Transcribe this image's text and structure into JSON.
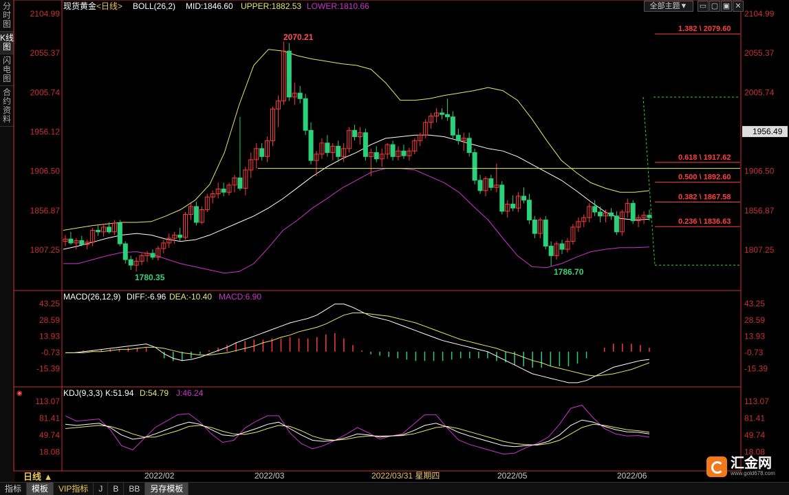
{
  "sidebar": {
    "items": [
      "分时图",
      "K线图",
      "闪电图",
      "合约资料"
    ],
    "active": 1
  },
  "top_controls": {
    "theme_label": "全部主题▼"
  },
  "main_header": {
    "name": "现货黄金",
    "period": "<日线>",
    "indicator": "BOLL(26,2)",
    "mid": "MID:1846.60",
    "upper": "UPPER:1882.53",
    "lower": "LOWER:1810.66"
  },
  "macd_header": {
    "name": "MACD(26,12,9)",
    "diff": "DIFF:-6.96",
    "dea": "DEA:-10.40",
    "macd": "MACD:6.90"
  },
  "kdj_header": {
    "name": "KDJ(9,3,3)",
    "k": "K:51.94",
    "d": "D:54.79",
    "j": "J:46.24"
  },
  "price_axis": {
    "ticks": [
      "2104.99",
      "2055.37",
      "2005.74",
      "1956.12",
      "1906.50",
      "1856.87",
      "1807.25"
    ],
    "current": "1956.49"
  },
  "macd_axis": {
    "ticks": [
      "43.25",
      "28.59",
      "13.93",
      "-0.73",
      "-15.39"
    ]
  },
  "kdj_axis": {
    "ticks": [
      "113.07",
      "81.41",
      "49.74",
      "18.08"
    ]
  },
  "fib_levels": [
    {
      "label": "1.382 \\ 2079.60",
      "value": 2079.6
    },
    {
      "label": "0.618 \\ 1917.62",
      "value": 1917.62
    },
    {
      "label": "0.500 \\ 1892.60",
      "value": 1892.6
    },
    {
      "label": "0.382 \\ 1867.58",
      "value": 1867.58
    },
    {
      "label": "0.236 \\ 1836.63",
      "value": 1836.63
    }
  ],
  "annotations": {
    "high": "2070.21",
    "low1": "1780.35",
    "low2": "1786.70"
  },
  "x_axis": {
    "labels": [
      "2022/02",
      "2022/03",
      "2022/03/31 星期四",
      "2022/05",
      "2022/06"
    ],
    "period_label": "日线 ▲"
  },
  "bottom_tabs": [
    "指标",
    "模板",
    "VIP指标",
    "J",
    "B",
    "BB",
    "另存模板"
  ],
  "brand": {
    "name": "汇金网",
    "url": "www.gold678.com"
  },
  "colors": {
    "up": "#ff3b3b",
    "down": "#2ad07a",
    "mid": "#ffffff",
    "upper": "#e8e86a",
    "lower": "#cc33cc",
    "axis": "#c83030"
  },
  "chart_data": {
    "type": "candlestick",
    "series_name": "现货黄金",
    "y_range": [
      1780,
      2110
    ],
    "candles": [
      {
        "o": 1818,
        "h": 1826,
        "l": 1812,
        "c": 1821
      },
      {
        "o": 1821,
        "h": 1830,
        "l": 1814,
        "c": 1816
      },
      {
        "o": 1816,
        "h": 1822,
        "l": 1808,
        "c": 1819
      },
      {
        "o": 1819,
        "h": 1825,
        "l": 1812,
        "c": 1814
      },
      {
        "o": 1814,
        "h": 1820,
        "l": 1808,
        "c": 1817
      },
      {
        "o": 1817,
        "h": 1835,
        "l": 1812,
        "c": 1832
      },
      {
        "o": 1832,
        "h": 1838,
        "l": 1825,
        "c": 1830
      },
      {
        "o": 1830,
        "h": 1840,
        "l": 1824,
        "c": 1836
      },
      {
        "o": 1836,
        "h": 1842,
        "l": 1828,
        "c": 1830
      },
      {
        "o": 1830,
        "h": 1845,
        "l": 1826,
        "c": 1841
      },
      {
        "o": 1841,
        "h": 1845,
        "l": 1812,
        "c": 1815
      },
      {
        "o": 1815,
        "h": 1818,
        "l": 1790,
        "c": 1795
      },
      {
        "o": 1795,
        "h": 1800,
        "l": 1782,
        "c": 1788
      },
      {
        "o": 1788,
        "h": 1798,
        "l": 1780,
        "c": 1793
      },
      {
        "o": 1793,
        "h": 1803,
        "l": 1788,
        "c": 1800
      },
      {
        "o": 1800,
        "h": 1806,
        "l": 1792,
        "c": 1803
      },
      {
        "o": 1803,
        "h": 1808,
        "l": 1795,
        "c": 1798
      },
      {
        "o": 1798,
        "h": 1812,
        "l": 1794,
        "c": 1809
      },
      {
        "o": 1809,
        "h": 1820,
        "l": 1803,
        "c": 1816
      },
      {
        "o": 1816,
        "h": 1828,
        "l": 1810,
        "c": 1822
      },
      {
        "o": 1822,
        "h": 1830,
        "l": 1815,
        "c": 1826
      },
      {
        "o": 1826,
        "h": 1835,
        "l": 1818,
        "c": 1823
      },
      {
        "o": 1823,
        "h": 1855,
        "l": 1820,
        "c": 1852
      },
      {
        "o": 1852,
        "h": 1866,
        "l": 1845,
        "c": 1862
      },
      {
        "o": 1862,
        "h": 1868,
        "l": 1838,
        "c": 1842
      },
      {
        "o": 1842,
        "h": 1862,
        "l": 1840,
        "c": 1858
      },
      {
        "o": 1858,
        "h": 1878,
        "l": 1855,
        "c": 1874
      },
      {
        "o": 1874,
        "h": 1882,
        "l": 1866,
        "c": 1878
      },
      {
        "o": 1878,
        "h": 1892,
        "l": 1872,
        "c": 1884
      },
      {
        "o": 1884,
        "h": 1892,
        "l": 1875,
        "c": 1880
      },
      {
        "o": 1880,
        "h": 1892,
        "l": 1876,
        "c": 1889
      },
      {
        "o": 1889,
        "h": 1902,
        "l": 1880,
        "c": 1898
      },
      {
        "o": 1898,
        "h": 1975,
        "l": 1882,
        "c": 1885
      },
      {
        "o": 1885,
        "h": 1912,
        "l": 1876,
        "c": 1908
      },
      {
        "o": 1908,
        "h": 1930,
        "l": 1898,
        "c": 1921
      },
      {
        "o": 1921,
        "h": 1942,
        "l": 1910,
        "c": 1935
      },
      {
        "o": 1935,
        "h": 1942,
        "l": 1920,
        "c": 1925
      },
      {
        "o": 1925,
        "h": 1950,
        "l": 1918,
        "c": 1945
      },
      {
        "o": 1945,
        "h": 1988,
        "l": 1938,
        "c": 1985
      },
      {
        "o": 1985,
        "h": 2002,
        "l": 1962,
        "c": 1995
      },
      {
        "o": 1995,
        "h": 2070,
        "l": 1990,
        "c": 2058
      },
      {
        "o": 2058,
        "h": 2068,
        "l": 1995,
        "c": 2000
      },
      {
        "o": 2000,
        "h": 2018,
        "l": 1990,
        "c": 2005
      },
      {
        "o": 2005,
        "h": 2014,
        "l": 1992,
        "c": 1998
      },
      {
        "o": 1998,
        "h": 2004,
        "l": 1952,
        "c": 1958
      },
      {
        "o": 1958,
        "h": 1968,
        "l": 1915,
        "c": 1920
      },
      {
        "o": 1920,
        "h": 1932,
        "l": 1900,
        "c": 1928
      },
      {
        "o": 1928,
        "h": 1948,
        "l": 1922,
        "c": 1942
      },
      {
        "o": 1942,
        "h": 1952,
        "l": 1925,
        "c": 1930
      },
      {
        "o": 1930,
        "h": 1942,
        "l": 1920,
        "c": 1938
      },
      {
        "o": 1938,
        "h": 1945,
        "l": 1918,
        "c": 1925
      },
      {
        "o": 1925,
        "h": 1942,
        "l": 1918,
        "c": 1935
      },
      {
        "o": 1935,
        "h": 1962,
        "l": 1930,
        "c": 1958
      },
      {
        "o": 1958,
        "h": 1965,
        "l": 1945,
        "c": 1950
      },
      {
        "o": 1950,
        "h": 1962,
        "l": 1940,
        "c": 1955
      },
      {
        "o": 1955,
        "h": 1960,
        "l": 1920,
        "c": 1925
      },
      {
        "o": 1925,
        "h": 1935,
        "l": 1900,
        "c": 1930
      },
      {
        "o": 1930,
        "h": 1938,
        "l": 1918,
        "c": 1922
      },
      {
        "o": 1922,
        "h": 1935,
        "l": 1912,
        "c": 1928
      },
      {
        "o": 1928,
        "h": 1942,
        "l": 1922,
        "c": 1940
      },
      {
        "o": 1940,
        "h": 1945,
        "l": 1920,
        "c": 1925
      },
      {
        "o": 1925,
        "h": 1938,
        "l": 1920,
        "c": 1932
      },
      {
        "o": 1932,
        "h": 1940,
        "l": 1922,
        "c": 1926
      },
      {
        "o": 1926,
        "h": 1936,
        "l": 1920,
        "c": 1932
      },
      {
        "o": 1932,
        "h": 1948,
        "l": 1928,
        "c": 1945
      },
      {
        "o": 1945,
        "h": 1955,
        "l": 1938,
        "c": 1952
      },
      {
        "o": 1952,
        "h": 1972,
        "l": 1948,
        "c": 1968
      },
      {
        "o": 1968,
        "h": 1980,
        "l": 1960,
        "c": 1976
      },
      {
        "o": 1976,
        "h": 1986,
        "l": 1968,
        "c": 1980
      },
      {
        "o": 1980,
        "h": 1986,
        "l": 1972,
        "c": 1978
      },
      {
        "o": 1978,
        "h": 1998,
        "l": 1970,
        "c": 1975
      },
      {
        "o": 1975,
        "h": 1982,
        "l": 1948,
        "c": 1952
      },
      {
        "o": 1952,
        "h": 1960,
        "l": 1940,
        "c": 1945
      },
      {
        "o": 1945,
        "h": 1955,
        "l": 1932,
        "c": 1948
      },
      {
        "o": 1948,
        "h": 1955,
        "l": 1925,
        "c": 1930
      },
      {
        "o": 1930,
        "h": 1935,
        "l": 1890,
        "c": 1895
      },
      {
        "o": 1895,
        "h": 1902,
        "l": 1878,
        "c": 1882
      },
      {
        "o": 1882,
        "h": 1900,
        "l": 1875,
        "c": 1897
      },
      {
        "o": 1897,
        "h": 1902,
        "l": 1882,
        "c": 1886
      },
      {
        "o": 1886,
        "h": 1916,
        "l": 1880,
        "c": 1889
      },
      {
        "o": 1889,
        "h": 1894,
        "l": 1852,
        "c": 1856
      },
      {
        "o": 1856,
        "h": 1870,
        "l": 1848,
        "c": 1865
      },
      {
        "o": 1865,
        "h": 1876,
        "l": 1856,
        "c": 1860
      },
      {
        "o": 1860,
        "h": 1880,
        "l": 1855,
        "c": 1875
      },
      {
        "o": 1875,
        "h": 1886,
        "l": 1866,
        "c": 1870
      },
      {
        "o": 1870,
        "h": 1878,
        "l": 1840,
        "c": 1845
      },
      {
        "o": 1845,
        "h": 1850,
        "l": 1822,
        "c": 1828
      },
      {
        "o": 1828,
        "h": 1848,
        "l": 1822,
        "c": 1845
      },
      {
        "o": 1845,
        "h": 1850,
        "l": 1808,
        "c": 1812
      },
      {
        "o": 1812,
        "h": 1818,
        "l": 1787,
        "c": 1800
      },
      {
        "o": 1800,
        "h": 1818,
        "l": 1795,
        "c": 1815
      },
      {
        "o": 1815,
        "h": 1820,
        "l": 1802,
        "c": 1808
      },
      {
        "o": 1808,
        "h": 1822,
        "l": 1804,
        "c": 1818
      },
      {
        "o": 1818,
        "h": 1840,
        "l": 1814,
        "c": 1836
      },
      {
        "o": 1836,
        "h": 1848,
        "l": 1830,
        "c": 1843
      },
      {
        "o": 1843,
        "h": 1852,
        "l": 1836,
        "c": 1848
      },
      {
        "o": 1848,
        "h": 1866,
        "l": 1842,
        "c": 1862
      },
      {
        "o": 1862,
        "h": 1870,
        "l": 1850,
        "c": 1855
      },
      {
        "o": 1855,
        "h": 1862,
        "l": 1842,
        "c": 1850
      },
      {
        "o": 1850,
        "h": 1858,
        "l": 1842,
        "c": 1854
      },
      {
        "o": 1854,
        "h": 1860,
        "l": 1845,
        "c": 1850
      },
      {
        "o": 1850,
        "h": 1856,
        "l": 1826,
        "c": 1830
      },
      {
        "o": 1830,
        "h": 1858,
        "l": 1825,
        "c": 1855
      },
      {
        "o": 1855,
        "h": 1872,
        "l": 1848,
        "c": 1866
      },
      {
        "o": 1866,
        "h": 1870,
        "l": 1840,
        "c": 1844
      },
      {
        "o": 1844,
        "h": 1852,
        "l": 1836,
        "c": 1848
      },
      {
        "o": 1848,
        "h": 1856,
        "l": 1840,
        "c": 1851
      },
      {
        "o": 1851,
        "h": 1858,
        "l": 1844,
        "c": 1848
      }
    ],
    "boll": {
      "mid": [
        1808,
        1812,
        1817,
        1822,
        1826,
        1828,
        1826,
        1821,
        1818,
        1820,
        1826,
        1834,
        1842,
        1850,
        1860,
        1872,
        1886,
        1900,
        1912,
        1922,
        1930,
        1940,
        1948,
        1950,
        1952,
        1952,
        1950,
        1945,
        1940,
        1935,
        1932,
        1925,
        1915,
        1905,
        1895,
        1882,
        1868,
        1855,
        1847,
        1845,
        1846
      ],
      "upper": [
        1832,
        1835,
        1838,
        1840,
        1842,
        1842,
        1843,
        1850,
        1858,
        1870,
        1890,
        1930,
        1990,
        2040,
        2060,
        2058,
        2052,
        2048,
        2045,
        2042,
        2040,
        2035,
        2018,
        1996,
        1996,
        1998,
        2002,
        2005,
        2008,
        2012,
        2008,
        1996,
        1972,
        1945,
        1920,
        1905,
        1892,
        1885,
        1880,
        1880,
        1882
      ],
      "lower": [
        1790,
        1790,
        1795,
        1800,
        1804,
        1805,
        1802,
        1796,
        1790,
        1786,
        1782,
        1778,
        1780,
        1790,
        1810,
        1832,
        1845,
        1860,
        1872,
        1885,
        1895,
        1905,
        1910,
        1910,
        1908,
        1900,
        1892,
        1880,
        1862,
        1845,
        1822,
        1800,
        1786,
        1785,
        1790,
        1798,
        1805,
        1808,
        1810,
        1810,
        1811
      ]
    },
    "macd": {
      "diff": [
        -1,
        -1,
        0,
        1,
        2,
        3,
        4,
        5,
        6,
        7,
        4,
        -2,
        -6,
        -8,
        -7,
        -5,
        -2,
        1,
        4,
        8,
        11,
        14,
        17,
        20,
        23,
        26,
        28,
        30,
        33,
        38,
        43,
        43,
        40,
        36,
        32,
        30,
        28,
        25,
        22,
        19,
        16,
        13,
        10,
        8,
        6,
        4,
        2,
        0,
        -4,
        -8,
        -12,
        -16,
        -20,
        -22,
        -24,
        -26,
        -28,
        -28,
        -26,
        -22,
        -18,
        -14,
        -12,
        -10,
        -8,
        -7
      ],
      "dea": [
        -1,
        -1,
        -1,
        0,
        0,
        1,
        2,
        2,
        3,
        4,
        4,
        3,
        1,
        -1,
        -2,
        -3,
        -3,
        -2,
        -1,
        1,
        3,
        5,
        8,
        10,
        13,
        15,
        18,
        20,
        22,
        25,
        29,
        33,
        35,
        35,
        34,
        33,
        32,
        30,
        28,
        26,
        23,
        20,
        17,
        14,
        11,
        9,
        7,
        5,
        3,
        0,
        -2,
        -5,
        -8,
        -10,
        -13,
        -15,
        -17,
        -19,
        -21,
        -22,
        -21,
        -20,
        -18,
        -16,
        -13,
        -10
      ],
      "hist": [
        0,
        0,
        1,
        1,
        2,
        2,
        2,
        3,
        3,
        3,
        0,
        -5,
        -7,
        -7,
        -5,
        -2,
        1,
        3,
        5,
        7,
        8,
        9,
        9,
        10,
        10,
        11,
        10,
        10,
        11,
        13,
        14,
        10,
        5,
        1,
        -2,
        -3,
        -4,
        -5,
        -6,
        -7,
        -7,
        -7,
        -7,
        -6,
        -5,
        -5,
        -5,
        -5,
        -7,
        -8,
        -10,
        -11,
        -12,
        -12,
        -11,
        -11,
        -11,
        -9,
        -5,
        0,
        3,
        6,
        6,
        6,
        5,
        3
      ]
    },
    "kdj": {
      "k": [
        70,
        68,
        70,
        72,
        64,
        50,
        42,
        45,
        52,
        60,
        68,
        74,
        70,
        60,
        50,
        48,
        55,
        62,
        70,
        74,
        62,
        50,
        40,
        38,
        40,
        45,
        52,
        50,
        46,
        48,
        50,
        58,
        68,
        72,
        65,
        55,
        48,
        42,
        36,
        30,
        28,
        30,
        32,
        38,
        50,
        68,
        78,
        74,
        66,
        60,
        56,
        55,
        52
      ],
      "d": [
        62,
        64,
        66,
        68,
        66,
        60,
        52,
        46,
        46,
        52,
        58,
        66,
        68,
        64,
        57,
        52,
        51,
        55,
        62,
        68,
        66,
        58,
        48,
        42,
        40,
        42,
        46,
        48,
        48,
        48,
        49,
        52,
        58,
        64,
        66,
        62,
        56,
        50,
        44,
        38,
        34,
        32,
        31,
        34,
        40,
        52,
        64,
        70,
        68,
        64,
        60,
        58,
        55
      ],
      "j": [
        86,
        76,
        78,
        80,
        60,
        30,
        22,
        43,
        64,
        76,
        88,
        90,
        74,
        52,
        36,
        40,
        63,
        76,
        86,
        86,
        54,
        34,
        24,
        30,
        40,
        51,
        64,
        54,
        42,
        48,
        52,
        70,
        88,
        88,
        63,
        41,
        32,
        26,
        20,
        14,
        16,
        26,
        34,
        46,
        70,
        100,
        106,
        82,
        62,
        52,
        48,
        49,
        46
      ]
    }
  }
}
